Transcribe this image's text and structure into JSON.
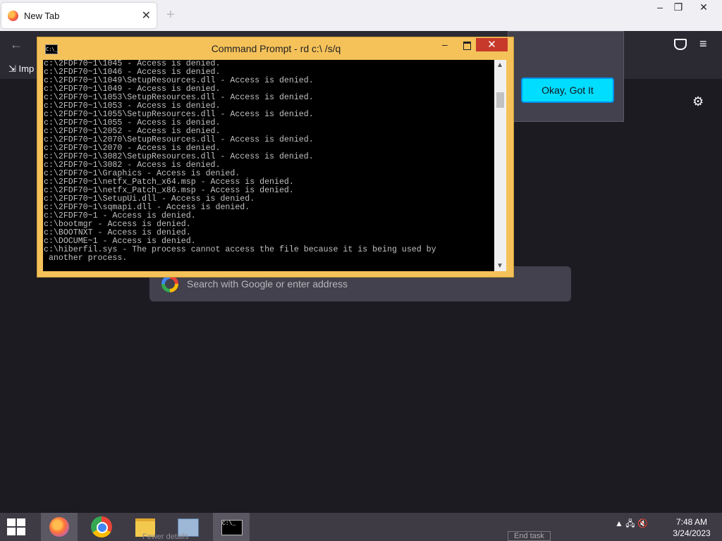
{
  "browser": {
    "tab_title": "New Tab",
    "tab_close": "✕",
    "new_tab": "+",
    "window_controls": {
      "minimize": "–",
      "restore": "❐",
      "close": "✕"
    },
    "bookmark_item": "Imp",
    "popup_button": "Okay, Got It",
    "search_placeholder": "Search with Google or enter address"
  },
  "cmd": {
    "icon_text": "C:\\_",
    "title": "Command Prompt - rd  c:\\ /s/q",
    "minimize": "–",
    "close": "✕",
    "lines": [
      "c:\\2FDF70~1\\1045 - Access is denied.",
      "c:\\2FDF70~1\\1046 - Access is denied.",
      "c:\\2FDF70~1\\1049\\SetupResources.dll - Access is denied.",
      "c:\\2FDF70~1\\1049 - Access is denied.",
      "c:\\2FDF70~1\\1053\\SetupResources.dll - Access is denied.",
      "c:\\2FDF70~1\\1053 - Access is denied.",
      "c:\\2FDF70~1\\1055\\SetupResources.dll - Access is denied.",
      "c:\\2FDF70~1\\1055 - Access is denied.",
      "c:\\2FDF70~1\\2052 - Access is denied.",
      "c:\\2FDF70~1\\2070\\SetupResources.dll - Access is denied.",
      "c:\\2FDF70~1\\2070 - Access is denied.",
      "c:\\2FDF70~1\\3082\\SetupResources.dll - Access is denied.",
      "c:\\2FDF70~1\\3082 - Access is denied.",
      "c:\\2FDF70~1\\Graphics - Access is denied.",
      "c:\\2FDF70~1\\netfx_Patch_x64.msp - Access is denied.",
      "c:\\2FDF70~1\\netfx_Patch_x86.msp - Access is denied.",
      "c:\\2FDF70~1\\SetupUi.dll - Access is denied.",
      "c:\\2FDF70~1\\sqmapi.dll - Access is denied.",
      "c:\\2FDF70~1 - Access is denied.",
      "c:\\bootmgr - Access is denied.",
      "c:\\BOOTNXT - Access is denied.",
      "c:\\DOCUME~1 - Access is denied.",
      "c:\\hiberfil.sys - The process cannot access the file because it is being used by",
      " another process."
    ]
  },
  "taskbar": {
    "cmd_icon_text": "C:\\_",
    "ghost_fewer_details": "Fewer details",
    "ghost_end_task": "End task",
    "tray_arrow": "▲",
    "clock_time": "7:48 AM",
    "clock_date": "3/24/2023"
  }
}
